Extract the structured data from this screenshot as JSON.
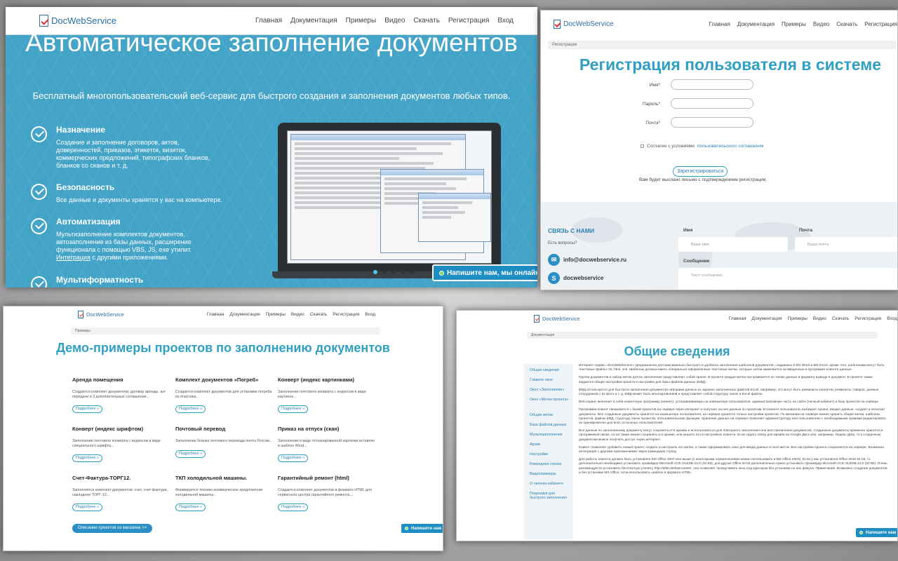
{
  "logo": "DocWebService",
  "nav": [
    "Главная",
    "Документация",
    "Примеры",
    "Видео",
    "Скачать",
    "Регистрация",
    "Вход"
  ],
  "chat_label": "Напишите нам, мы онлайн!",
  "chat_short": "Напишите нам",
  "home": {
    "title": "Автоматическое заполнение документов",
    "subtitle": "Бесплатный многопользовательский веб-сервис для быстрого создания и заполнения документов любых типов.",
    "features": [
      {
        "title": "Назначение",
        "desc": "Создание и заполнение договоров, актов, доверенностей, приказов, этикеток, визиток, коммерческих предложений, типографских бланков, бланков со сканов и т. д."
      },
      {
        "title": "Безопасность",
        "desc": "Все данные и документы хранятся у вас на компьютере."
      },
      {
        "title": "Автоматизация",
        "desc": "Мультизаполнение комплектов документов, автозаполнение из базы данных, расширение функционала с помощью VBS, JS, exe утилит.",
        "link": "Интеграция",
        "desc_after": " с другими приложениями."
      },
      {
        "title": "Мультиформатность",
        "desc": ""
      }
    ],
    "slider_count": 5,
    "slider_active": 0
  },
  "register": {
    "breadcrumb": "Регистрация",
    "title": "Регистрация пользователя в системе",
    "fields": [
      {
        "label": "Имя*"
      },
      {
        "label": "Пароль*"
      },
      {
        "label": "Почта*"
      }
    ],
    "agree_text": "Согласен с условиями",
    "agree_link": "пользовательского соглашения",
    "button": "Зарегистрироваться",
    "note": "Вам будет выслано письмо с подтверждением регистрации.",
    "contact_title": "СВЯЗЬ С НАМИ",
    "contact_question": "Есть вопросы?",
    "email": "info@docwebservice.ru",
    "skype": "docwebservice",
    "form_name_label": "Имя",
    "form_name_ph": "Ваше имя",
    "form_mail_label": "Почта",
    "form_mail_ph": "Ваша почта",
    "form_msg_label": "Сообщение",
    "form_msg_ph": "Текст сообщения..."
  },
  "examples": {
    "breadcrumb": "Примеры",
    "title": "Демо-примеры проектов по заполнению документов",
    "more": "Подробнее »",
    "cards": [
      {
        "title": "Аренда помещения",
        "desc": "Создается комплект документов: договор аренды, акт передачи и 3 дополнительных соглашения..."
      },
      {
        "title": "Комплект документов «Погреб»",
        "desc": "Создается комплект документов для установки погреба из пластика..."
      },
      {
        "title": "Конверт (индекс картинками)",
        "desc": "Заполнение почтового конверта с индексом в виде картинок..."
      },
      {
        "title": "Конверт (индекс шрифтом)",
        "desc": "Заполнение почтового конверта с индексом в виде специального шрифта..."
      },
      {
        "title": "Почтовый перевод",
        "desc": "Заполнение бланка почтового перевода почты России..."
      },
      {
        "title": "Приказ на отпуск (скан)",
        "desc": "Заполнение в виде отсканированной картинки вставлен в шаблон Word..."
      },
      {
        "title": "Счет-Фактура-ТОРГ12.",
        "desc": "Заполняется комплект документов: счет, счет-фактура, накладная ТОРГ-12..."
      },
      {
        "title": "ТКП холодильной машины.",
        "desc": "Формируется технико-коммерческое предложение холодильной машины..."
      },
      {
        "title": "Гарантийный ремонт (html)",
        "desc": "Создается комплект документов в формате HTML для сервисного центра гарантийного ремонта..."
      }
    ],
    "store_button": "Описание проектов из магазина >>"
  },
  "docs": {
    "breadcrumb": "Документация",
    "title": "Общие сведения",
    "sidebar": [
      "Общие сведения",
      "Главное окно",
      "Окно «Заполнение»",
      "Окно «Метки проекта»",
      "Общие метки",
      "База файлов данных",
      "Мультизаполнение",
      "Архив",
      "Настройки",
      "Командная строка",
      "Видеопримеры",
      "О личном кабинете",
      "Подсказки для быстрого заполнения"
    ],
    "paragraphs": [
      "Интернет-сервис «DocWebService» предназначен для максимально быстрого и удобного заполнения шаблонов документов, созданных в MS Word и MS Excel, кроме того, шаблонами могут быть текстовые файлы: txt, html, xml. Шаблоны должны иметь специально оформленные текстовые метки, которые затем заменяются на введенные в программе-клиенте данные.",
      "Группа документов и набор меток для их заполнения представляют собой проект. В проекте каждая метка настраивается по типам данных и формату вывода в документ. В проекте также задаются общие настройки проекта и настройки для базы файлов данных (БФД).",
      "БФД используется для быстрого заполнения документов наборами данных из заранее заполненных файлов Excel, например, это могут быть реквизиты клиентов, реквизиты товаров, данные сотрудников с их фото и т. д. БФД может быть многоуровневой и представляет собой структуру папок и Excel файлы.",
      "Веб-сервис включает в себя клиентскую программу (клиент), устанавливаемую на компьютере пользователя, административную часть на сайте (личный кабинет) и базу проектов на сервере.",
      "Программа-клиент связывается с базой проектов на сервере через интернет и получает из нее данные по проектам. В клиенте пользователь выбирает проект, вводит данные, создает и печатает документы. Все созданные документы хранятся на компьютере пользователя, на сервере хранятся только настройки проектов. По желанию на сервере можно хранить общие метки, шаблоны проектов, файлы БФД, структуру папок проектов, пользовательские функции. Хранение данных на сервере позволяет администратору или пользователю с необходимыми правами редактировать их одновременно для всех остальных пользователей.",
      "Все данные по заполненному документу могут сохраняться в архиве и использоваться для повторного заполнения или восстановления документов. Созданные документы временно хранятся в программной папке, но их также можно сохранять и в архиве, или указать его в настройках клиента. Если задать папку для архива на Google Диск или, например, Яндекс Диск, то к созданным документам можно получить доступ через интернет.",
      "Клиент позволяет добавить новый проект, создать и настроить его метки, а также сформировать окно для ввода данных в поля меток. Все настройки проекта сохраняются на сервере. Возможна интеграция с другими приложениями через командную строку.",
      "Для работы клиента должен быть установлен MS Office 2007 или выше (с некоторыми ограничениями можно использовать и MS Office 2003). Если у вас установлен Office 2010 64 bit, то дополнительно необходимо установить провайдер Microsoft.ACE.OLEDB.12.0 (32 Bit), для других Office 64 bit дополнительно нужно установить провайдер Microsoft.ACE.OLEDB.14.0 (32 Bit). Очень рекомендуется установить бесплатную утилиту http://ahkt.de/katcrouser/, она позволяет прокручивать окна под курсором без установки на них фокуса. Примечание. Возможно создание документов и без установки MS Office, если использовать шаблон в формате HTML."
    ]
  }
}
